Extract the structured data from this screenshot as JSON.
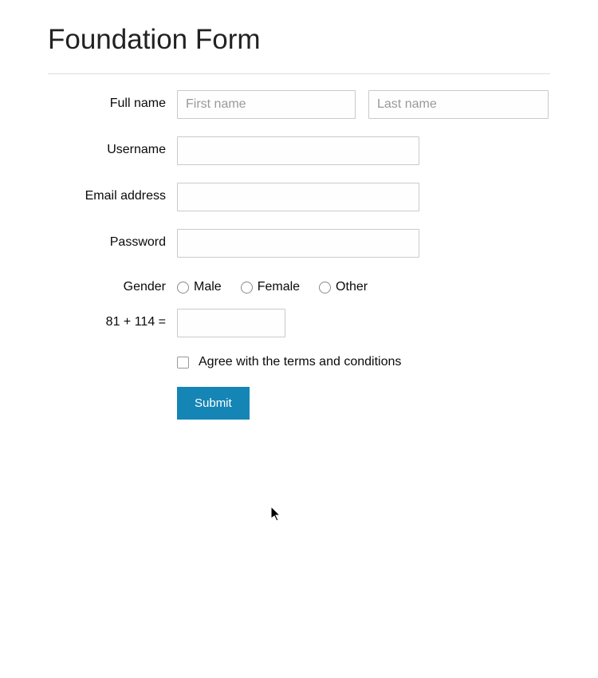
{
  "title": "Foundation Form",
  "labels": {
    "full_name": "Full name",
    "username": "Username",
    "email": "Email address",
    "password": "Password",
    "gender": "Gender",
    "captcha": "81 + 114 ="
  },
  "placeholders": {
    "first_name": "First name",
    "last_name": "Last name"
  },
  "values": {
    "first_name": "",
    "last_name": "",
    "username": "",
    "email": "",
    "password": "",
    "captcha": ""
  },
  "gender_options": {
    "male": "Male",
    "female": "Female",
    "other": "Other"
  },
  "terms_label": "Agree with the terms and conditions",
  "submit_label": "Submit",
  "colors": {
    "primary": "#1585b5"
  }
}
